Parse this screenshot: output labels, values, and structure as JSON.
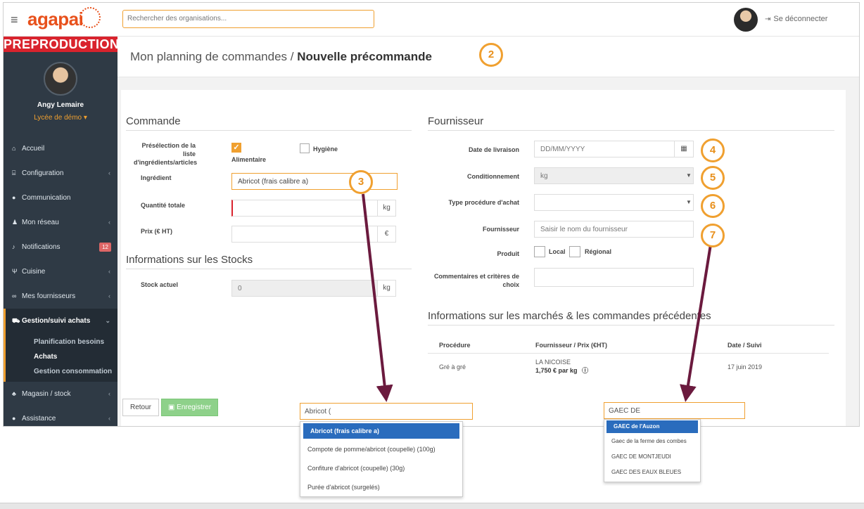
{
  "header": {
    "menu_icon": "hamburger-icon",
    "logo_text": "agapai",
    "search_placeholder": "Rechercher des organisations...",
    "logout_label": "Se déconnecter"
  },
  "sidebar": {
    "banner": "PREPRODUCTION",
    "user_name": "Angy Lemaire",
    "user_org": "Lycée de démo ▾",
    "items": [
      {
        "icon": "home-icon",
        "glyph": "⌂",
        "label": "Accueil",
        "chevron": ""
      },
      {
        "icon": "bank-icon",
        "glyph": "⌸",
        "label": "Configuration",
        "chevron": "‹"
      },
      {
        "icon": "comments-icon",
        "glyph": "●",
        "label": "Communication",
        "chevron": ""
      },
      {
        "icon": "users-icon",
        "glyph": "♟",
        "label": "Mon réseau",
        "chevron": "‹"
      },
      {
        "icon": "bell-icon",
        "glyph": "♪",
        "label": "Notifications",
        "badge": "12",
        "chevron": ""
      },
      {
        "icon": "utensils-icon",
        "glyph": "Ψ",
        "label": "Cuisine",
        "chevron": "‹"
      },
      {
        "icon": "handshake-icon",
        "glyph": "∞",
        "label": "Mes fournisseurs",
        "chevron": "‹"
      }
    ],
    "active_item": {
      "icon": "cart-icon",
      "glyph": "⛟",
      "label": "Gestion/suivi achats",
      "chevron": "⌄"
    },
    "sub_items": [
      "Planification besoins",
      "Achats",
      "Gestion consommation"
    ],
    "after_items": [
      {
        "icon": "cubes-icon",
        "glyph": "♣",
        "label": "Magasin / stock",
        "chevron": "‹"
      },
      {
        "icon": "help-icon",
        "glyph": "●",
        "label": "Assistance",
        "chevron": "‹"
      }
    ]
  },
  "page": {
    "title_prefix": "Mon planning de commandes / ",
    "title_strong": "Nouvelle précommande"
  },
  "callouts": [
    "2",
    "3",
    "4",
    "5",
    "6",
    "7"
  ],
  "commande": {
    "section_title": "Commande",
    "preselection_label": "Présélection de la liste d'ingrédients/articles",
    "check_alimentaire": "Alimentaire",
    "check_hygiene": "Hygiène",
    "ingredient_label": "Ingrédient",
    "ingredient_value": "Abricot (frais calibre a)",
    "quantite_label": "Quantité totale",
    "quantite_unit": "kg",
    "prix_label": "Prix (€ HT)",
    "prix_unit": "€"
  },
  "stocks": {
    "section_title": "Informations sur les Stocks",
    "stock_label": "Stock actuel",
    "stock_value": "0",
    "stock_unit": "kg"
  },
  "fournisseur": {
    "section_title": "Fournisseur",
    "date_label": "Date de livraison",
    "date_placeholder": "DD/MM/YYYY",
    "conditionnement_label": "Conditionnement",
    "conditionnement_value": "kg",
    "procedure_label": "Type procédure d'achat",
    "fournisseur_label": "Fournisseur",
    "fournisseur_placeholder": "Saisir le nom du fournisseur",
    "produit_label": "Produit",
    "produit_local": "Local",
    "produit_regional": "Régional",
    "commentaires_label": "Commentaires et critères de choix"
  },
  "marches": {
    "section_title": "Informations sur les marchés & les commandes précédentes",
    "columns": [
      "Procédure",
      "Fournisseur / Prix (€HT)",
      "Date / Suivi"
    ],
    "row": {
      "procedure": "Gré à gré",
      "supplier": "LA NICOISE",
      "price": "1,750 € par kg",
      "date": "17 juin 2019"
    }
  },
  "buttons": {
    "back": "Retour",
    "save": "Enregistrer"
  },
  "ingredient_autocomplete": {
    "query": "Abricot (",
    "options": [
      "Abricot (frais calibre a)",
      "Compote de pomme/abricot (coupelle) (100g)",
      "Confiture d'abricot (coupelle) (30g)",
      "Purée d'abricot (surgelés)"
    ]
  },
  "supplier_autocomplete": {
    "query": "GAEC DE",
    "options": [
      "GAEC de l'Auzon",
      "Gaec de la ferme des combes",
      "GAEC DE MONTJEUDI",
      "GAEC DES EAUX BLEUES"
    ]
  },
  "colors": {
    "accent": "#f0a030",
    "brand": "#e8511c",
    "sidebar": "#2f3a45",
    "arrow": "#6b1a3e",
    "selected": "#2a6cbd"
  }
}
